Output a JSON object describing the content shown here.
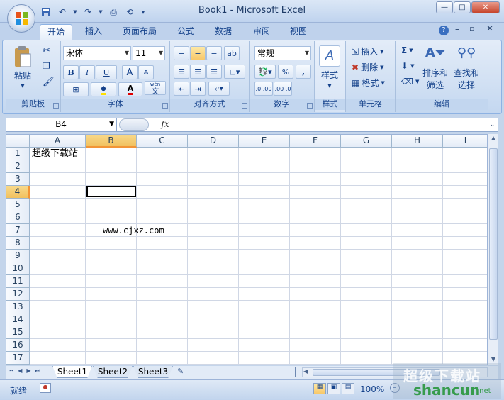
{
  "window": {
    "title": "Book1 - Microsoft Excel"
  },
  "tabs": [
    "开始",
    "插入",
    "页面布局",
    "公式",
    "数据",
    "审阅",
    "视图"
  ],
  "ribbon": {
    "clipboard": {
      "label": "剪贴板",
      "paste": "粘贴"
    },
    "font": {
      "label": "字体",
      "name": "宋体",
      "size": "11",
      "bold": "B",
      "italic": "I",
      "underline": "U",
      "grow": "A",
      "shrink": "A",
      "fontcolor": "A",
      "wen": "wén",
      "wen_char": "文"
    },
    "align": {
      "label": "对齐方式"
    },
    "number": {
      "label": "数字",
      "format": "常规",
      "percent": "%",
      "comma": ",",
      "inc": ".0 .00",
      "dec": ".00 .0"
    },
    "styles": {
      "label": "样式"
    },
    "cells": {
      "label": "单元格",
      "insert": "插入",
      "delete": "删除",
      "format": "格式"
    },
    "editing": {
      "label": "编辑",
      "sort_line1": "排序和",
      "sort_line2": "筛选",
      "find_line1": "查找和",
      "find_line2": "选择",
      "sigma": "Σ"
    }
  },
  "formula_bar": {
    "name_box": "B4",
    "fx": "fx",
    "content": ""
  },
  "columns": [
    "A",
    "B",
    "C",
    "D",
    "E",
    "F",
    "G",
    "H",
    "I"
  ],
  "rows": [
    "1",
    "2",
    "3",
    "4",
    "5",
    "6",
    "7",
    "8",
    "9",
    "10",
    "11",
    "12",
    "13",
    "14",
    "15",
    "16",
    "17"
  ],
  "selected": {
    "column": "B",
    "row": "4"
  },
  "cells": {
    "A1": "超级下载站",
    "B7": "www.cjxz.com"
  },
  "sheets": [
    "Sheet1",
    "Sheet2",
    "Sheet3"
  ],
  "active_sheet": "Sheet1",
  "status": {
    "ready": "就绪",
    "zoom": "100%"
  },
  "watermark": {
    "line1": "超级下载站",
    "line2": "shancun",
    "line3": ".net"
  }
}
